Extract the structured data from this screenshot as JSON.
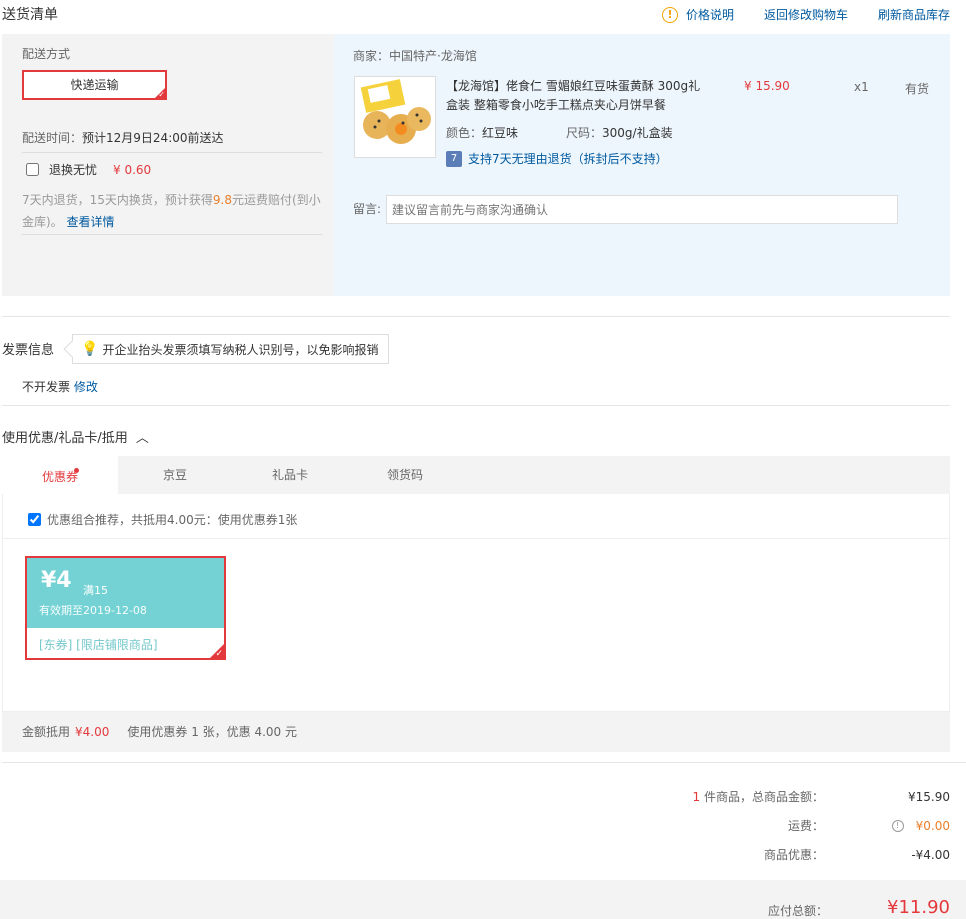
{
  "header": {
    "title": "送货清单",
    "price_note": "价格说明",
    "back_cart": "返回修改购物车",
    "refresh_stock": "刷新商品库存"
  },
  "delivery": {
    "label": "配送方式",
    "method": "快递运输",
    "time_label": "配送时间：",
    "time_value": "预计12月9日24:00前送达",
    "exchange_label": "退换无忧",
    "exchange_price": "¥ 0.60",
    "desc_pre": "7天内退货，15天内换货，预计获得",
    "desc_num": "9.8",
    "desc_post": "元运费赔付(到小金库)。",
    "desc_link": "查看详情"
  },
  "product": {
    "merchant": "商家：中国特产·龙海馆",
    "name": "【龙海馆】佬食仁 雪媚娘红豆味蛋黄酥 300g礼盒装 整箱零食小吃手工糕点夹心月饼早餐",
    "price": "¥ 15.90",
    "qty": "x1",
    "stock": "有货",
    "color_label": "颜色：",
    "color_value": "红豆味",
    "size_label": "尺码：",
    "size_value": "300g/礼盒装",
    "return_badge": "7",
    "return_text": "支持7天无理由退货（拆封后不支持）",
    "note_label": "留言:",
    "note_placeholder": "建议留言前先与商家沟通确认"
  },
  "invoice": {
    "title": "发票信息",
    "tip": "开企业抬头发票须填写纳税人识别号，以免影响报销",
    "value": "不开发票",
    "modify": "修改"
  },
  "discount": {
    "title": "使用优惠/礼品卡/抵用",
    "tabs": [
      "优惠券",
      "京豆",
      "礼品卡",
      "领货码"
    ],
    "combo_text": "优惠组合推荐，共抵用4.00元：使用优惠券1张",
    "coupon": {
      "amount": "¥4",
      "condition": "满15",
      "expire": "有效期至2019-12-08",
      "tags": "[东券]  [限店铺限商品]"
    },
    "summary_label": "金额抵用",
    "summary_amount": "¥4.00",
    "summary_text": "使用优惠券 1 张，优惠 4.00 元"
  },
  "totals": {
    "count": "1",
    "goods_label": " 件商品，总商品金额：",
    "goods_value": "¥15.90",
    "ship_label": "运费：",
    "ship_value": "¥0.00",
    "disc_label": "商品优惠：",
    "disc_value": "-¥4.00",
    "grand_label": "应付总额：",
    "grand_value": "¥11.90"
  },
  "colors": {
    "accent_red": "#e4393c",
    "link_blue": "#005aa0",
    "coupon_teal": "#74d2d4",
    "product_bg": "#eef6fd"
  }
}
